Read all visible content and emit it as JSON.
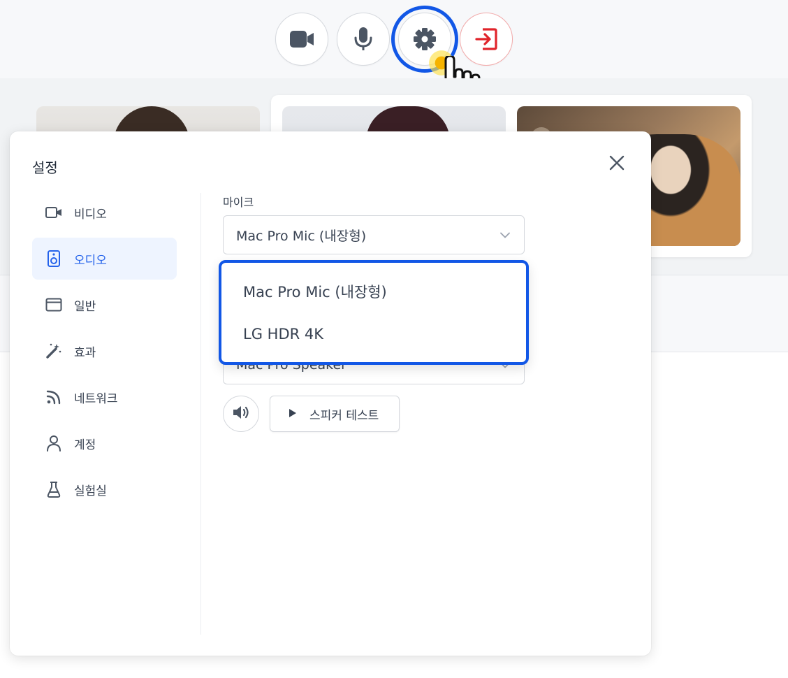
{
  "toolbar": {
    "buttons": [
      {
        "icon": "video-camera-icon",
        "state": "on"
      },
      {
        "icon": "microphone-icon",
        "state": "on"
      },
      {
        "icon": "gear-icon",
        "state": "focused"
      },
      {
        "icon": "leave-icon",
        "state": "danger"
      }
    ],
    "accent": "#1257e6",
    "danger": "#e0242b"
  },
  "settings": {
    "title": "설정",
    "close_icon": "close-icon",
    "nav": [
      {
        "label": "비디오",
        "icon": "video-camera-icon"
      },
      {
        "label": "오디오",
        "icon": "speaker-icon",
        "active": true
      },
      {
        "label": "일반",
        "icon": "window-icon"
      },
      {
        "label": "효과",
        "icon": "magic-wand-icon"
      },
      {
        "label": "네트워크",
        "icon": "rss-icon"
      },
      {
        "label": "계정",
        "icon": "user-icon"
      },
      {
        "label": "실험실",
        "icon": "flask-icon"
      }
    ],
    "active_color": "#2563eb",
    "mic": {
      "label": "마이크",
      "selected": "Mac Pro Mic (내장형)",
      "options": [
        "Mac Pro Mic (내장형)",
        "LG HDR 4K"
      ]
    },
    "speaker": {
      "selected": "Mac Pro Speaker",
      "test_label": "스피커 테스트"
    }
  }
}
